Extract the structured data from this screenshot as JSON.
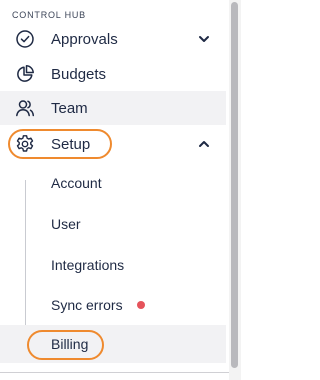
{
  "section_title": "CONTROL HUB",
  "nav": {
    "approvals": {
      "label": "Approvals",
      "icon": "check-circle-icon",
      "chevron": "chevron-down-icon"
    },
    "budgets": {
      "label": "Budgets",
      "icon": "pie-chart-icon"
    },
    "team": {
      "label": "Team",
      "icon": "users-icon"
    },
    "setup": {
      "label": "Setup",
      "icon": "gear-icon",
      "chevron": "chevron-up-icon"
    }
  },
  "setup_children": [
    {
      "label": "Account"
    },
    {
      "label": "User"
    },
    {
      "label": "Integrations"
    },
    {
      "label": "Sync errors",
      "indicator": "error-dot"
    },
    {
      "label": "Billing"
    }
  ],
  "colors": {
    "text": "#1f2a44",
    "selected_bg": "#f2f2f4",
    "error_dot": "#e5535b",
    "highlight_ring": "#ef8a2e",
    "tree_line": "#c9cbd1"
  }
}
